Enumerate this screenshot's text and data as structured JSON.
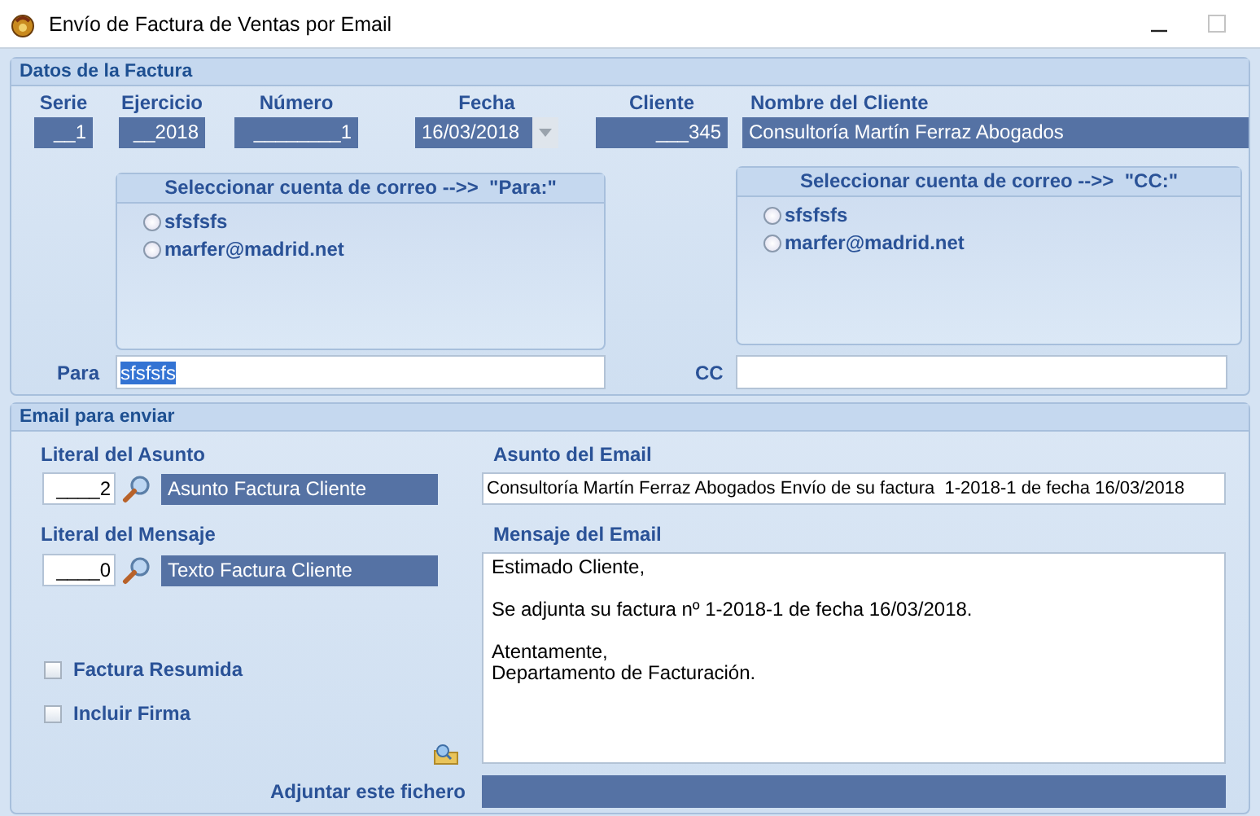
{
  "window": {
    "title": "Envío de Factura de Ventas por Email"
  },
  "invoice": {
    "title": "Datos de la Factura",
    "fields": [
      {
        "label": "Serie",
        "value": "__1",
        "kind": "number"
      },
      {
        "label": "Ejercicio",
        "value": "__2018",
        "kind": "number"
      },
      {
        "label": "Número",
        "value": "________1",
        "kind": "number"
      },
      {
        "label": "Fecha",
        "value": "16/03/2018",
        "kind": "dropdown"
      },
      {
        "label": "Cliente",
        "value": "___345",
        "kind": "number"
      },
      {
        "label": "Nombre del Cliente",
        "value": "Consultoría Martín Ferraz Abogados",
        "kind": "name"
      }
    ],
    "to_accounts": {
      "title": "Seleccionar cuenta de correo -->>  \"Para:\"",
      "options": [
        {
          "label": "sfsfsfs",
          "selected": false
        },
        {
          "label": "marfer@madrid.net",
          "selected": false
        }
      ]
    },
    "cc_accounts": {
      "title": "Seleccionar cuenta de correo -->>  \"CC:\"",
      "options": [
        {
          "label": "sfsfsfs",
          "selected": false
        },
        {
          "label": "marfer@madrid.net",
          "selected": false
        }
      ]
    },
    "to": {
      "label": "Para",
      "value": "sfsfsfs",
      "text_selected": true
    },
    "cc": {
      "label": "CC"
    }
  },
  "email": {
    "title": "Email para enviar",
    "subject_literal": {
      "label": "Literal del Asunto",
      "code": "____2",
      "name": "Asunto Factura Cliente"
    },
    "message_literal": {
      "label": "Literal del Mensaje",
      "code": "____0",
      "name": "Texto Factura Cliente"
    },
    "subject": {
      "label": "Asunto del Email",
      "value": "Consultoría Martín Ferraz Abogados Envío de su factura  1-2018-1 de fecha 16/03/2018"
    },
    "message": {
      "label": "Mensaje del Email",
      "paragraphs": [
        [
          "Estimado Cliente,"
        ],
        [
          "Se adjunta su factura nº 1-2018-1 de fecha 16/03/2018."
        ],
        [
          "Atentamente,",
          "Departamento de Facturación."
        ]
      ]
    },
    "checkboxes": [
      {
        "label": "Factura Resumida",
        "checked": false
      },
      {
        "label": "Incluir Firma",
        "checked": false
      }
    ],
    "attachment": {
      "label": "Adjuntar este fichero"
    }
  }
}
